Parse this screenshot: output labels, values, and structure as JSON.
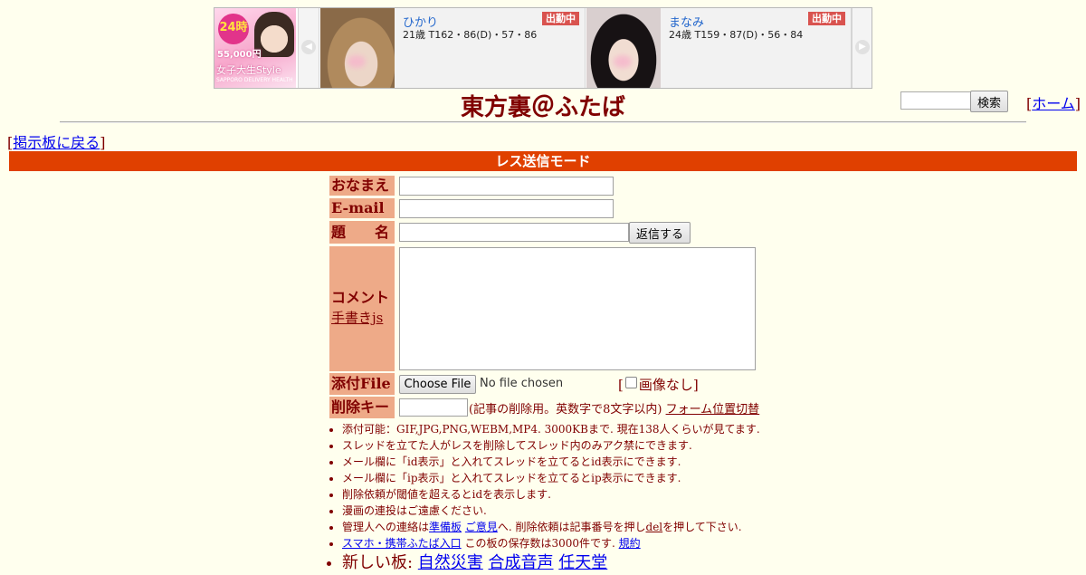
{
  "ad": {
    "logo_badge": "24時",
    "logo_price": "55,000円",
    "logo_name": "女子大生Style",
    "logo_sub": "SAPPORO DELIVERY HEALTH",
    "cards": [
      {
        "name": "ひかり",
        "status": "出勤中",
        "info": "21歳 T162・86(D)・57・86"
      },
      {
        "name": "まなみ",
        "status": "出勤中",
        "info": "24歳 T159・87(D)・56・84"
      }
    ]
  },
  "header": {
    "title": "東方裏＠ふたば",
    "search_button": "検索",
    "home_link": "ホーム",
    "back_link": "掲示板に戻る"
  },
  "mode_bar": "レス送信モード",
  "form": {
    "name_label": "おなまえ",
    "email_label": "E-mail",
    "subject_label": "題　　名",
    "submit_button": "返信する",
    "comment_label": "コメント",
    "handwrite_link": "手書きjs",
    "file_label": "添付File",
    "choose_file_button": "Choose File",
    "no_file_text": "No file chosen",
    "no_image_label": "画像なし",
    "delete_key_label": "削除キー",
    "delete_key_note": "(記事の削除用。英数字で8文字以内)",
    "form_position_link": "フォーム位置切替"
  },
  "notes": {
    "line1": "添付可能：GIF,JPG,PNG,WEBM,MP4. 3000KBまで. 現在138人くらいが見てます.",
    "line2": "スレッドを立てた人がレスを削除してスレッド内のみアク禁にできます.",
    "line3": "メール欄に「id表示」と入れてスレッドを立てるとid表示にできます.",
    "line4": "メール欄に「ip表示」と入れてスレッドを立てるとip表示にできます.",
    "line5": "削除依頼が閾値を超えるとidを表示します.",
    "line6": "漫画の連投はご遠慮ください.",
    "line7_prefix": "管理人への連絡は",
    "line7_link1": "準備板",
    "line7_link2": "ご意見",
    "line7_mid": "へ. 削除依頼は記事番号を押し",
    "line7_link3": "del",
    "line7_suffix": "を押して下さい.",
    "line8_link": "スマホ・携帯ふたば入口",
    "line8_mid": " この板の保存数は3000件です.",
    "line8_link2": "規約",
    "line9_prefix": "新しい板: ",
    "line9_links": [
      "自然災害",
      "合成音声",
      "任天堂"
    ]
  }
}
